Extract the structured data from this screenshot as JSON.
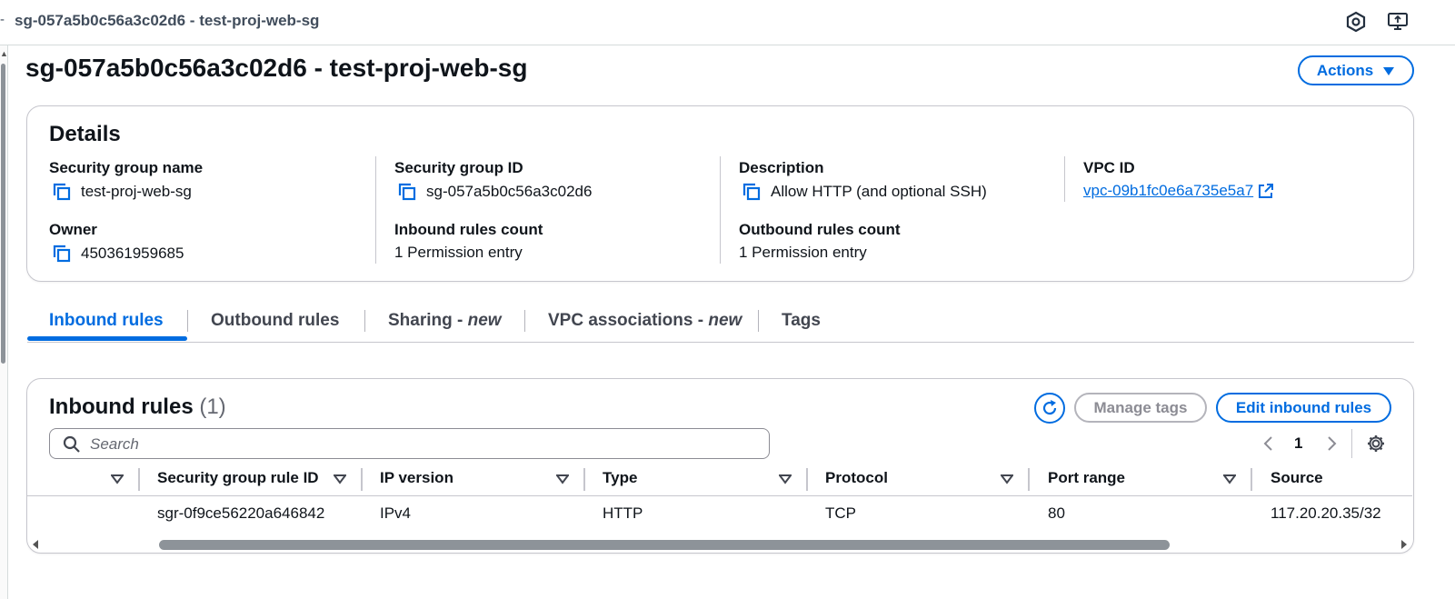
{
  "topbar": {
    "title": "sg-057a5b0c56a3c02d6 - test-proj-web-sg",
    "icons": [
      "hexagon-settings-icon",
      "screen-share-icon"
    ]
  },
  "page": {
    "title": "sg-057a5b0c56a3c02d6 - test-proj-web-sg",
    "actions_label": "Actions"
  },
  "details": {
    "heading": "Details",
    "security_group_name": {
      "label": "Security group name",
      "value": "test-proj-web-sg"
    },
    "security_group_id": {
      "label": "Security group ID",
      "value": "sg-057a5b0c56a3c02d6"
    },
    "description": {
      "label": "Description",
      "value": "Allow HTTP (and optional SSH)"
    },
    "vpc_id": {
      "label": "VPC ID",
      "value": "vpc-09b1fc0e6a735e5a7"
    },
    "owner": {
      "label": "Owner",
      "value": "450361959685"
    },
    "inbound_rules_count": {
      "label": "Inbound rules count",
      "value": "1 Permission entry"
    },
    "outbound_rules_count": {
      "label": "Outbound rules count",
      "value": "1 Permission entry"
    }
  },
  "tabs": [
    {
      "label": "Inbound rules",
      "suffix": "",
      "active": true
    },
    {
      "label": "Outbound rules",
      "suffix": "",
      "active": false
    },
    {
      "label": "Sharing - ",
      "suffix": "new",
      "active": false
    },
    {
      "label": "VPC associations - ",
      "suffix": "new",
      "active": false
    },
    {
      "label": "Tags",
      "suffix": "",
      "active": false
    }
  ],
  "inbound": {
    "heading": "Inbound rules",
    "count": "(1)",
    "manage_tags_label": "Manage tags",
    "edit_label": "Edit inbound rules",
    "search_placeholder": "Search",
    "page_number": "1",
    "columns": [
      "Security group rule ID",
      "IP version",
      "Type",
      "Protocol",
      "Port range",
      "Source"
    ],
    "rows": [
      [
        "sgr-0f9ce56220a646842",
        "IPv4",
        "HTTP",
        "TCP",
        "80",
        "117.20.20.35/32"
      ]
    ]
  },
  "colors": {
    "accent": "#006ce0",
    "border": "#c6c6cd",
    "text": "#0f141a"
  }
}
